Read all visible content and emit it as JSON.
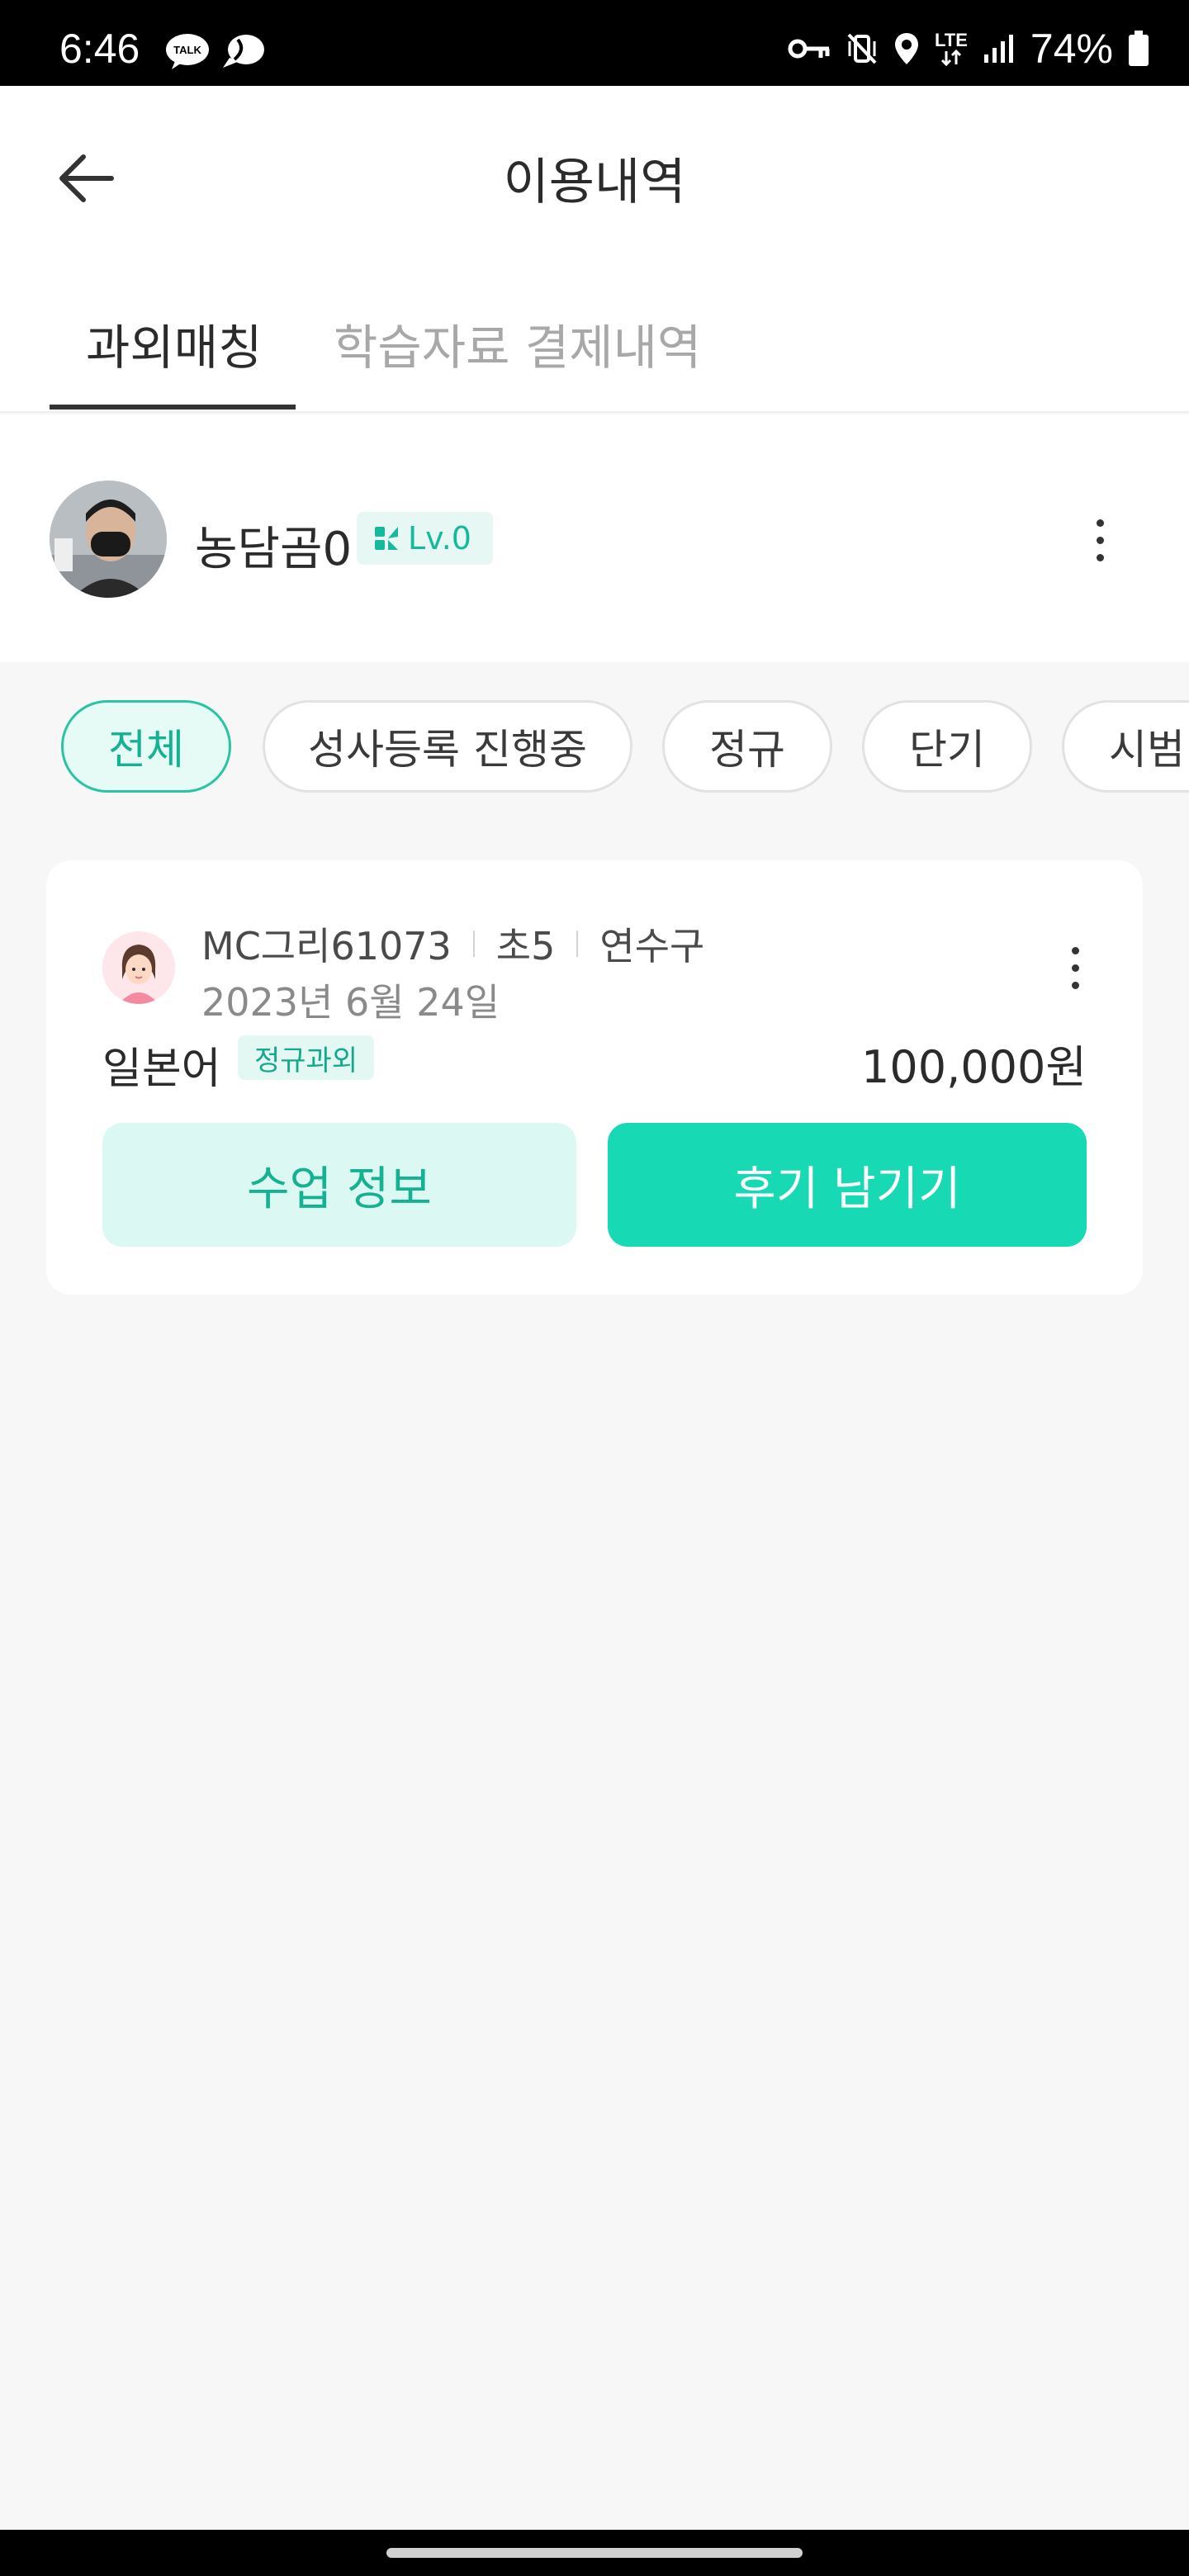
{
  "status_bar": {
    "time": "6:46",
    "network": "LTE",
    "battery": "74%",
    "icons": [
      "kakaotalk-icon",
      "chat-cloud-icon",
      "vpn-key-icon",
      "vibrate-mute-icon",
      "location-icon",
      "lte-icon",
      "signal-icon",
      "battery-icon"
    ]
  },
  "header": {
    "title": "이용내역",
    "back_icon": "back-arrow-icon"
  },
  "tabs": [
    {
      "label": "과외매칭",
      "active": true
    },
    {
      "label": "학습자료 결제내역",
      "active": false
    }
  ],
  "profile": {
    "name": "농담곰0",
    "level": "Lv.0"
  },
  "filters": [
    "전체",
    "성사등록 진행중",
    "정규",
    "단기",
    "시범"
  ],
  "active_filter": "전체",
  "card": {
    "tutor_name": "MC그리61073",
    "grade": "초5",
    "region": "연수구",
    "date": "2023년 6월 24일",
    "subject": "일본어",
    "type": "정규과외",
    "price": "100,000원",
    "info_button": "수업 정보",
    "review_button": "후기 남기기"
  },
  "colors": {
    "accent": "#17d9b4",
    "accent_text": "#14b293",
    "accent_light": "#dcf8f2",
    "background": "#f7f7f7"
  }
}
